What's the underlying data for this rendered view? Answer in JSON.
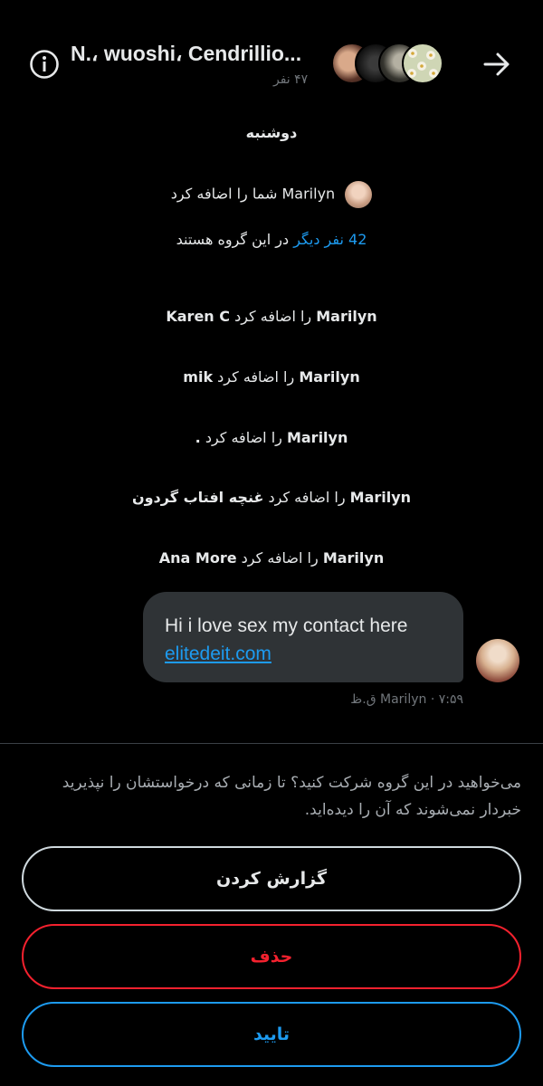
{
  "header": {
    "title": "N.، wuoshi، Cendrillio...",
    "member_count": "۴۷ نفر"
  },
  "system_messages": {
    "day": "دوشنبه",
    "added_you_name": "Marilyn",
    "added_you_text": "شما را اضافه کرد",
    "others_count_link": "42 نفر دیگر",
    "others_text": "در این گروه هستند",
    "events": [
      {
        "actor": "Marilyn",
        "verb": "را اضافه کرد",
        "target": "Karen C"
      },
      {
        "actor": "Marilyn",
        "verb": "را اضافه کرد",
        "target": "mik"
      },
      {
        "actor": "Marilyn",
        "verb": "را اضافه کرد",
        "target": "."
      },
      {
        "actor": "Marilyn",
        "verb": "را اضافه کرد",
        "target": "غنچه افتاب گردون"
      },
      {
        "actor": "Marilyn",
        "verb": "را اضافه کرد",
        "target": "Ana More"
      }
    ]
  },
  "message": {
    "text": "Hi i love sex my contact here",
    "link": "elitedeit.com",
    "meta": "Marilyn · ۷:۵۹ ق.ظ"
  },
  "request": {
    "notice": "می‌خواهید در این گروه شرکت کنید؟ تا زمانی که درخواستشان را نپذیرید خبردار نمی‌شوند که آن را دیده‌اید.",
    "report_label": "گزارش کردن",
    "delete_label": "حذف",
    "accept_label": "تایید"
  },
  "colors": {
    "background": "#000000",
    "accent": "#1d9bf0",
    "danger": "#f4212e",
    "bubble": "#2f3336"
  },
  "icons": [
    "info-icon",
    "arrow-right-icon"
  ]
}
